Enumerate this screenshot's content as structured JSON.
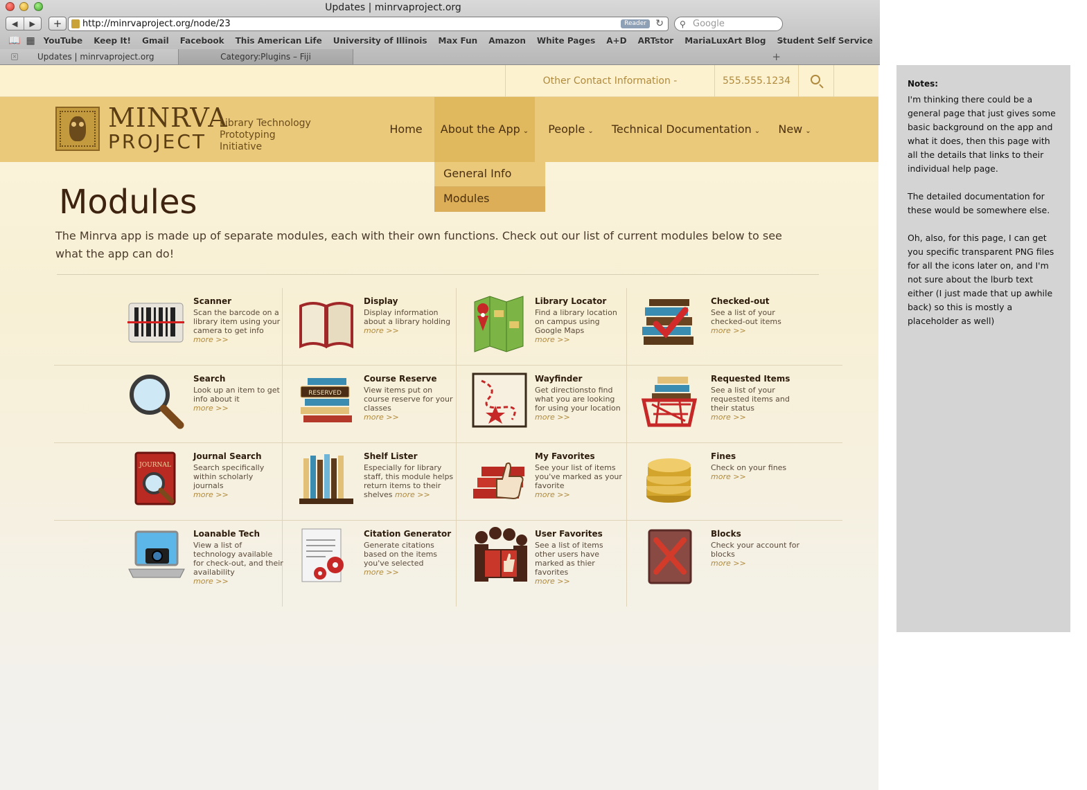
{
  "browser": {
    "window_title": "Updates | minrvaproject.org",
    "url": "http://minrvaproject.org/node/23",
    "reader_label": "Reader",
    "search_placeholder": "Google",
    "bookmarks": [
      "YouTube",
      "Keep It!",
      "Gmail",
      "Facebook",
      "This American Life",
      "University of Illinois",
      "Max Fun",
      "Amazon",
      "White Pages",
      "A+D",
      "ARTstor",
      "MariaLuxArt Blog",
      "Student Self Service"
    ],
    "tabs": [
      "Updates | minrvaproject.org",
      "Category:Plugins – Fiji"
    ]
  },
  "topbar": {
    "contact": "Other Contact Information - email@uiuc.edu",
    "phone": "555.555.1234"
  },
  "header": {
    "brand_line1": "MINRVA",
    "brand_line2": "PROJECT",
    "tagline": "Library Technology Prototyping Initiative",
    "nav": [
      {
        "label": "Home",
        "caret": ""
      },
      {
        "label": "About the App",
        "caret": "⌄"
      },
      {
        "label": "People",
        "caret": "⌄"
      },
      {
        "label": "Technical Documentation",
        "caret": "⌄"
      },
      {
        "label": "New",
        "caret": "⌄"
      }
    ],
    "dropdown": [
      "General Info",
      "Modules"
    ]
  },
  "main": {
    "title": "Modules",
    "intro": "The Minrva app is made up of separate modules, each with their own functions. Check out our list of current modules below to see what the app can do!",
    "more_label": "more >>",
    "modules": [
      {
        "name": "Scanner",
        "desc": "Scan the barcode on a library item using your camera to get info",
        "icon": "barcode-scanner-icon"
      },
      {
        "name": "Display",
        "desc": "Display information about a library holding",
        "icon": "open-book-icon"
      },
      {
        "name": "Library Locator",
        "desc": "Find a library location on campus using Google Maps",
        "icon": "map-pin-icon"
      },
      {
        "name": "Checked-out",
        "desc": "See a list of your checked-out items",
        "icon": "books-checkmark-icon"
      },
      {
        "name": "Search",
        "desc": "Look up an item to get info about it",
        "icon": "magnifier-icon"
      },
      {
        "name": "Course Reserve",
        "desc": "View items put on course reserve for your classes",
        "icon": "reserved-books-icon"
      },
      {
        "name": "Wayfinder",
        "desc": "Get directionsto find what you are looking for using your location",
        "icon": "route-map-icon"
      },
      {
        "name": "Requested Items",
        "desc": "See a list of your requested items and their status",
        "icon": "basket-books-icon"
      },
      {
        "name": "Journal Search",
        "desc": "Search specifically within scholarly journals",
        "icon": "journal-magnifier-icon"
      },
      {
        "name": "Shelf Lister",
        "desc": "Especially for library staff, this module helps return items to their shelves",
        "icon": "bookshelf-icon"
      },
      {
        "name": "My Favorites",
        "desc": "See your list of items you've marked as your favorite",
        "icon": "thumbs-up-books-icon"
      },
      {
        "name": "Fines",
        "desc": "Check on your fines",
        "icon": "coins-icon"
      },
      {
        "name": "Loanable Tech",
        "desc": "View a list of technology available for check-out, and their availability",
        "icon": "laptop-camera-icon"
      },
      {
        "name": "Citation Generator",
        "desc": "Generate citations based on the items you've selected",
        "icon": "citation-gears-icon"
      },
      {
        "name": "User Favorites",
        "desc": "See a list of items other users have marked as thier favorites",
        "icon": "people-book-icon"
      },
      {
        "name": "Blocks",
        "desc": "Check your account for blocks",
        "icon": "blocked-book-icon"
      }
    ]
  },
  "notes": {
    "title": "Notes:",
    "paragraphs": [
      "I'm thinking there could be a general page that just gives some basic background on the app and what it does, then this page with all the details that links to their individual help page.",
      "The detailed documentation for these would be somewhere else.",
      "Oh, also, for this page, I can get you specific transparent PNG files for all the icons later on, and I'm not sure about the lburb text either (I just made that up awhile back) so this is mostly a placeholder as well)"
    ]
  },
  "colors": {
    "header": "#ebc97a",
    "nav_active": "#e0b85e",
    "accent_link": "#b08a3c",
    "notes_bg": "#d4d4d4"
  }
}
